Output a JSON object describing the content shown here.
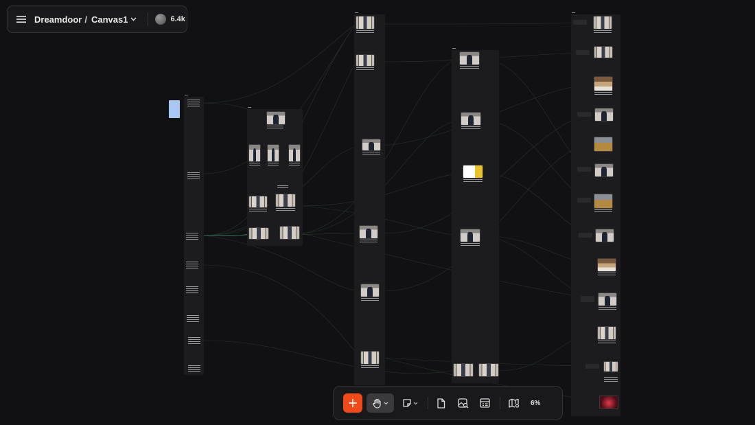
{
  "header": {
    "workspace": "Dreamdoor",
    "separator": "/",
    "canvas_name": "Canvas1",
    "credits": "6.4k"
  },
  "toolbar": {
    "zoom": "6%",
    "tools": [
      "add-icon",
      "hand-icon",
      "sticky-note-icon",
      "document-icon",
      "image-search-icon",
      "layout-icon",
      "map-icon"
    ]
  },
  "colors": {
    "background": "#111012",
    "accent": "#f04a1a",
    "note": "#a9c8ef"
  }
}
